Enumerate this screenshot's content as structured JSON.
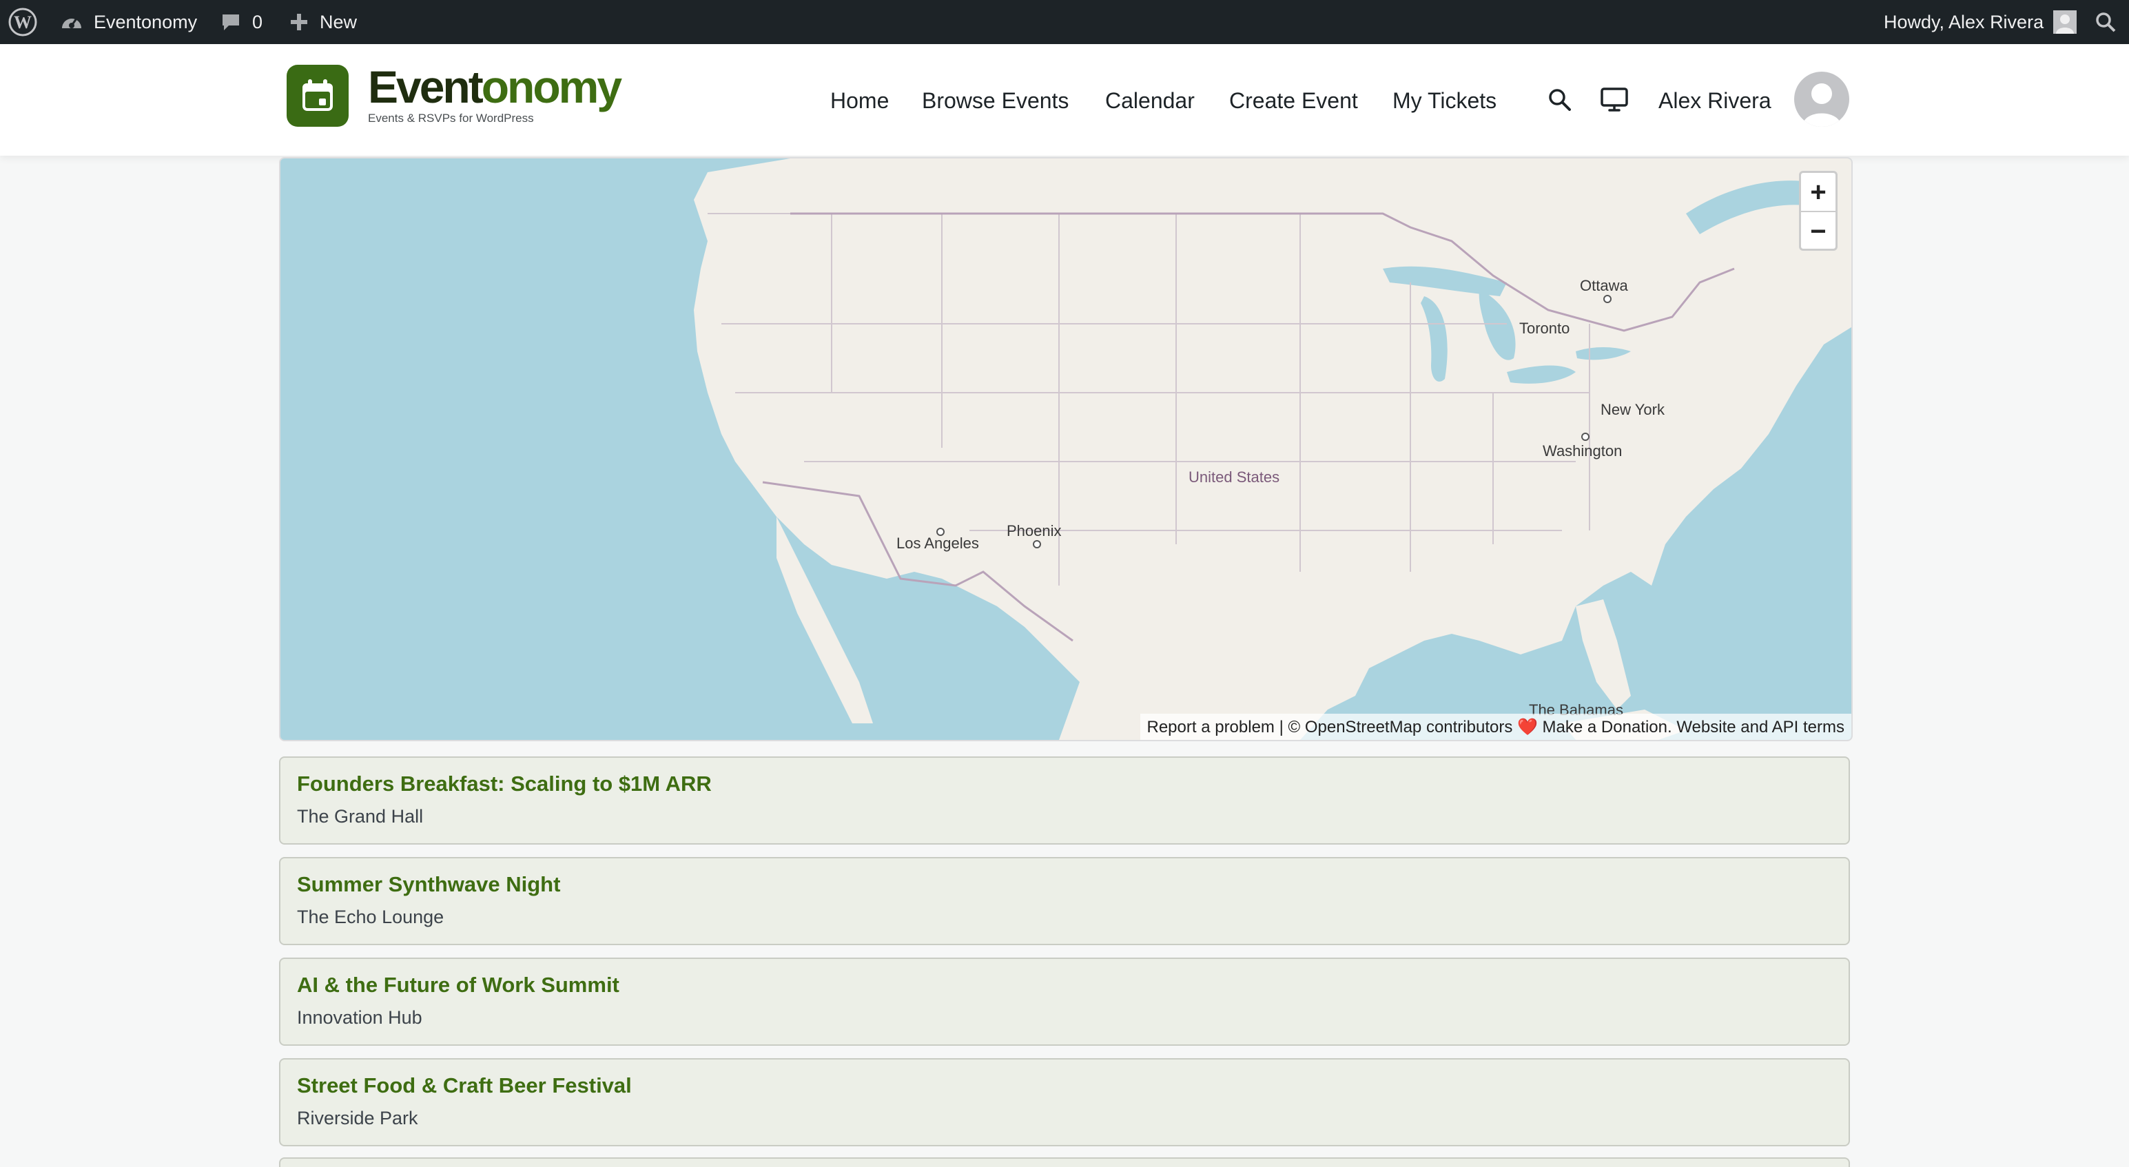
{
  "admin_bar": {
    "site_name": "Eventonomy",
    "comments_count": "0",
    "new_label": "New",
    "greeting": "Howdy, Alex Rivera"
  },
  "header": {
    "logo_word_part1": "Event",
    "logo_word_part2": "onomy",
    "tagline": "Events & RSVPs for WordPress",
    "nav": [
      "Home",
      "Browse Events",
      "Calendar",
      "Create Event",
      "My Tickets"
    ],
    "user_name": "Alex Rivera"
  },
  "map": {
    "zoom_in": "+",
    "zoom_out": "−",
    "attribution": "Report a problem | © OpenStreetMap contributors ❤️ Make a Donation. Website and API terms",
    "labels": {
      "country": "United States",
      "ottawa": "Ottawa",
      "toronto": "Toronto",
      "new_york": "New York",
      "washington": "Washington",
      "phoenix": "Phoenix",
      "los_angeles": "Los Angeles",
      "bahamas": "The Bahamas"
    }
  },
  "events": [
    {
      "title": "Founders Breakfast: Scaling to $1M ARR",
      "venue": "The Grand Hall"
    },
    {
      "title": "Summer Synthwave Night",
      "venue": "The Echo Lounge"
    },
    {
      "title": "AI & the Future of Work Summit",
      "venue": "Innovation Hub"
    },
    {
      "title": "Street Food & Craft Beer Festival",
      "venue": "Riverside Park"
    }
  ],
  "colors": {
    "brand_green": "#3e6d12",
    "admin_bar_bg": "#1d2327",
    "water": "#aad3df",
    "land": "#f2efe9"
  },
  "icons": {
    "wp_logo": "wordpress-logo-icon",
    "dashboard": "dashboard-icon",
    "comments": "comment-bubble-icon",
    "new": "plus-icon",
    "search": "search-icon",
    "display": "monitor-icon"
  }
}
